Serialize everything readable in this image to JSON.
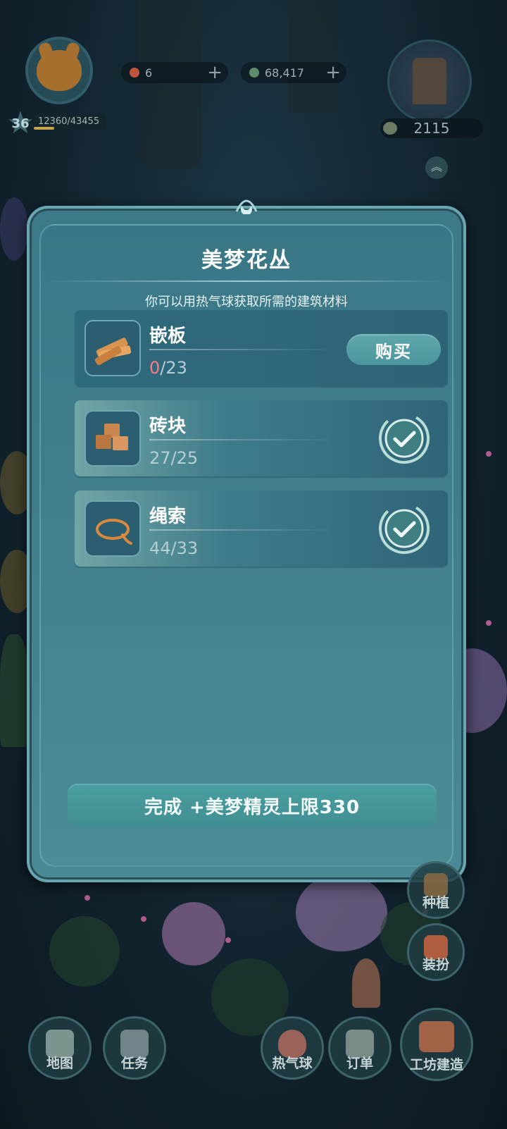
{
  "hud": {
    "level": "36",
    "xp_text": "12360/43455",
    "xp_fraction": 0.284,
    "currency_1_value": "6",
    "currency_2_value": "68,417",
    "population_value": "2115"
  },
  "dialog": {
    "title": "美梦花丛",
    "subtitle": "你可以用热气球获取所需的建筑材料",
    "items": [
      {
        "name": "嵌板",
        "have": "0",
        "need": "/23",
        "status": "insufficient",
        "action_label": "购买",
        "icon": "wood-plank-icon"
      },
      {
        "name": "砖块",
        "count": "27/25",
        "status": "complete",
        "icon": "brick-icon"
      },
      {
        "name": "绳索",
        "count": "44/33",
        "status": "complete",
        "icon": "rope-icon"
      }
    ],
    "complete_label": "完成 +美梦精灵上限330"
  },
  "side_buttons": [
    {
      "label": "种植",
      "icon": "plant-icon"
    },
    {
      "label": "装扮",
      "icon": "decorate-hammer-icon"
    }
  ],
  "nav": [
    {
      "label": "地图",
      "icon": "map-icon"
    },
    {
      "label": "任务",
      "icon": "task-clipboard-icon"
    },
    {
      "label": "热气球",
      "icon": "hot-air-balloon-icon"
    },
    {
      "label": "订单",
      "icon": "order-scroll-icon"
    },
    {
      "label": "工坊建造",
      "icon": "workshop-house-icon"
    }
  ],
  "colors": {
    "dialog_bg": "#3f7c88",
    "row_bg": "#2f6a7c",
    "buy_button": "#5fa7ad",
    "shortage_red": "#ff7a86",
    "complete_button": "#4a9fa0"
  }
}
